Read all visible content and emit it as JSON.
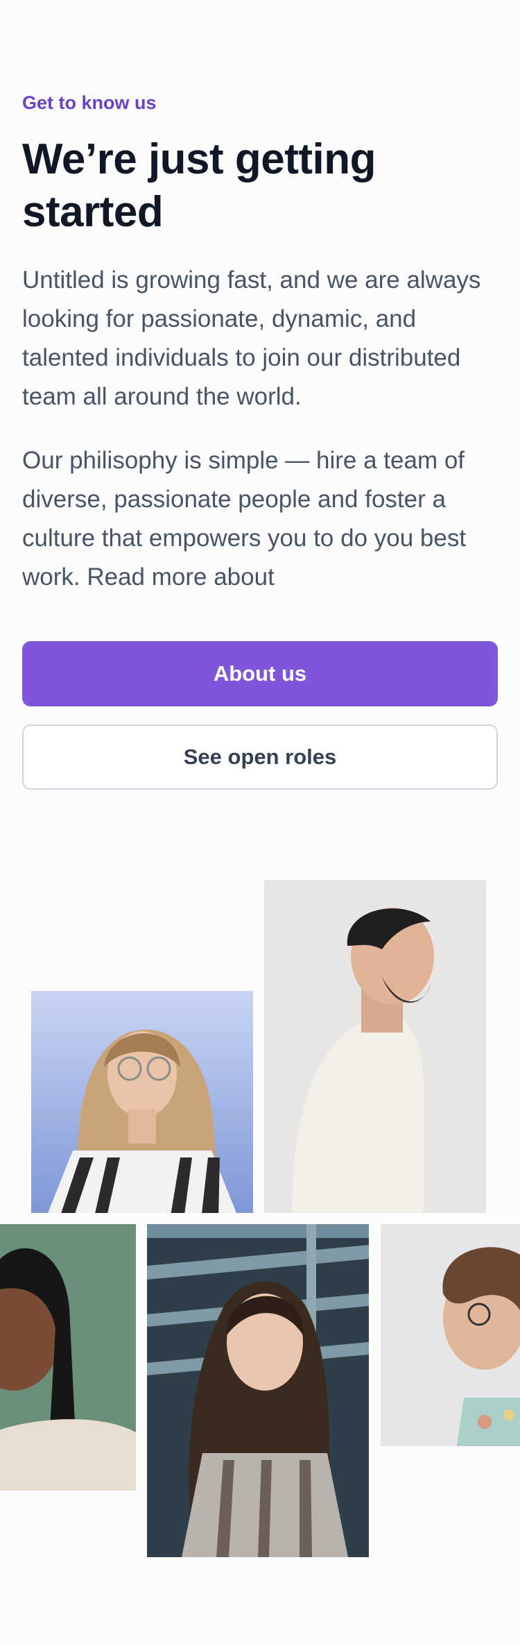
{
  "intro": {
    "eyebrow": "Get to know us",
    "heading": "We’re just getting started",
    "paragraph_1": "Untitled is growing fast, and we are always looking for passionate, dynamic, and talented individuals to join our distributed team all around the world.",
    "paragraph_2": "Our philisophy is simple — hire a team of diverse, passionate people and foster a culture that empowers you to do you best work. Read more about"
  },
  "actions": {
    "primary_label": "About us",
    "secondary_label": "See open roles"
  },
  "colors": {
    "brand": "#7f56d9",
    "eyebrow": "#6941c6",
    "heading": "#101828",
    "body": "#475467",
    "secondary_border": "#d0d5dd"
  },
  "gallery": {
    "photos": [
      "woman-with-glasses-photo",
      "man-in-profile-photo",
      "woman-with-braids-photo",
      "woman-by-stairs-photo",
      "man-with-curly-hair-photo"
    ]
  }
}
